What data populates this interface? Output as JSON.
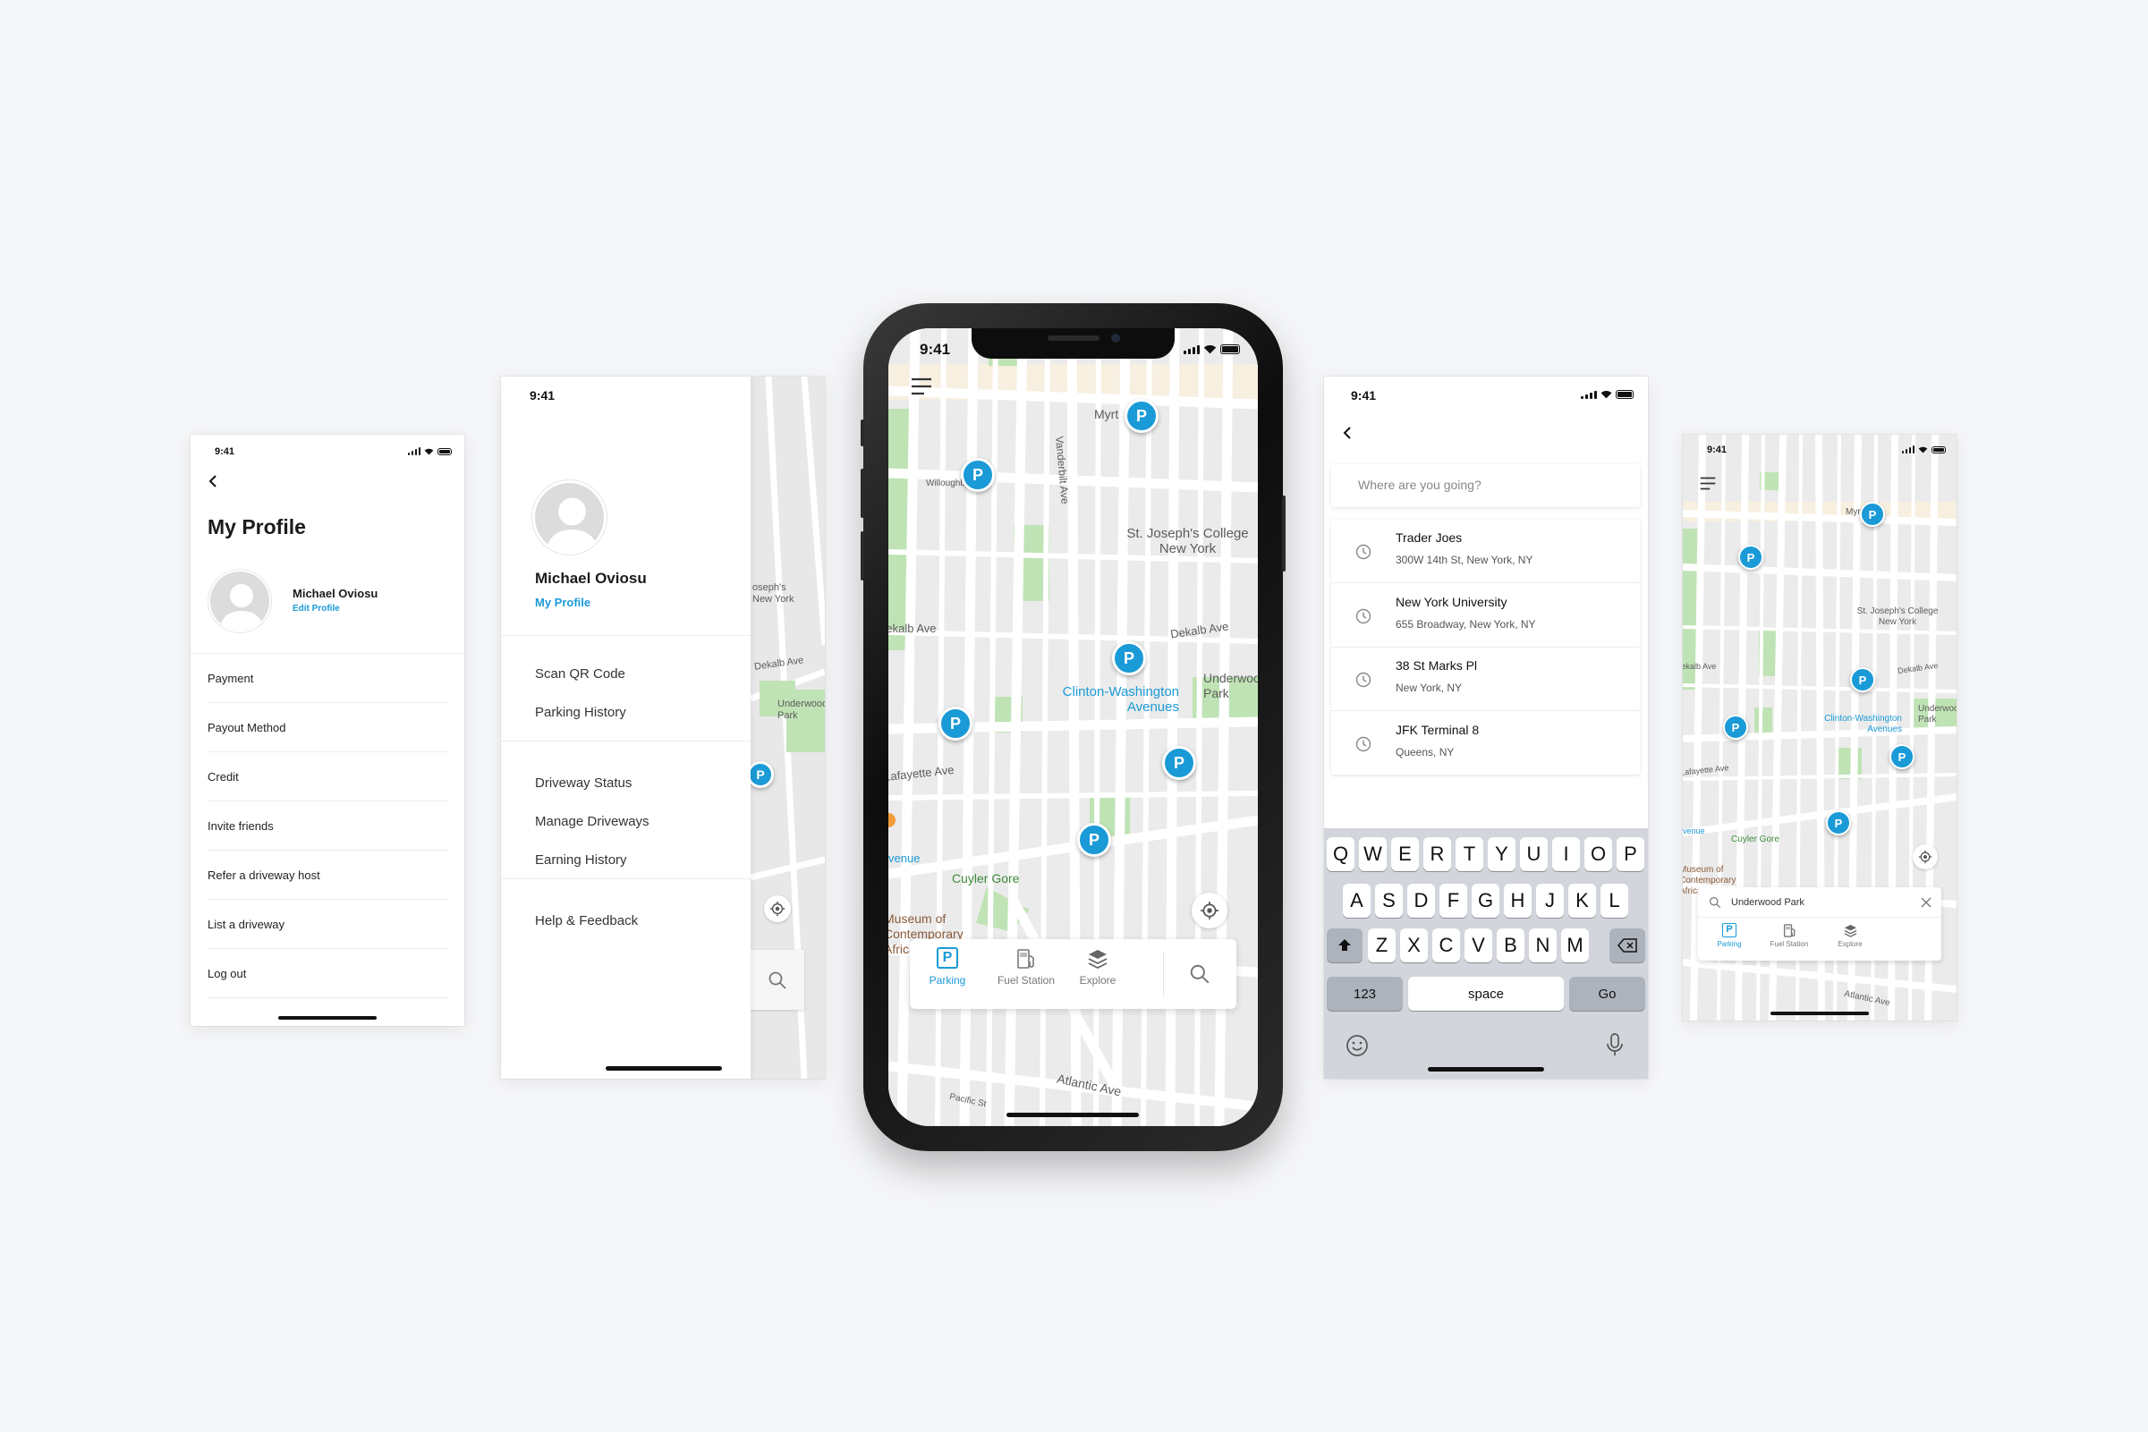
{
  "status_time": "9:41",
  "profile_screen": {
    "title": "My Profile",
    "user_name": "Michael Oviosu",
    "edit_link": "Edit Profile",
    "menu": [
      "Payment",
      "Payout Method",
      "Credit",
      "Invite friends",
      "Refer a driveway host",
      "List a driveway",
      "Log out"
    ]
  },
  "drawer_screen": {
    "user_name": "Michael Oviosu",
    "profile_link": "My Profile",
    "group1": [
      "Scan QR Code",
      "Parking History"
    ],
    "group2": [
      "Driveway Status",
      "Manage Driveways",
      "Earning History"
    ],
    "group3": [
      "Help & Feedback"
    ]
  },
  "map": {
    "labels": {
      "myrt": "Myrt",
      "st_joseph": "St. Joseph's College New York",
      "dekalb_w": "Dekalb Ave",
      "dekalb_e": "Dekalb Ave",
      "underwood": "Underwood Park",
      "clinton": "Clinton-Washington Avenues",
      "lafayette": "Lafayette Ave",
      "cuyler": "Cuyler Gore",
      "museum": "Museum of Contemporary African...",
      "atlantic": "Atlantic Ave",
      "pacific": "Pacific St",
      "willoughby": "Willoughby Ave",
      "vanderbilt": "Vanderbilt Ave",
      "venue_partial": "venue",
      "joseph_partial": "oseph's New York"
    },
    "pin_letter": "P"
  },
  "bottom_nav": {
    "parking": "Parking",
    "fuel": "Fuel Station",
    "explore": "Explore"
  },
  "search_screen": {
    "placeholder": "Where are you going?",
    "results": [
      {
        "name": "Trader Joes",
        "address": "300W 14th St, New York, NY"
      },
      {
        "name": "New York University",
        "address": "655 Broadway, New York, NY"
      },
      {
        "name": "38 St Marks Pl",
        "address": "New York, NY"
      },
      {
        "name": "JFK Terminal 8",
        "address": "Queens, NY"
      }
    ],
    "keyboard": {
      "row1": [
        "Q",
        "W",
        "E",
        "R",
        "T",
        "Y",
        "U",
        "I",
        "O",
        "P"
      ],
      "row2": [
        "A",
        "S",
        "D",
        "F",
        "G",
        "H",
        "J",
        "K",
        "L"
      ],
      "row3": [
        "Z",
        "X",
        "C",
        "V",
        "B",
        "N",
        "M"
      ],
      "numbers": "123",
      "space": "space",
      "go": "Go"
    }
  },
  "search_map_screen": {
    "search_value": "Underwood Park"
  },
  "colors": {
    "accent": "#1a9ad6",
    "map_bg": "#eeeeee",
    "park": "#bfe3b4",
    "road": "#ffffff"
  }
}
